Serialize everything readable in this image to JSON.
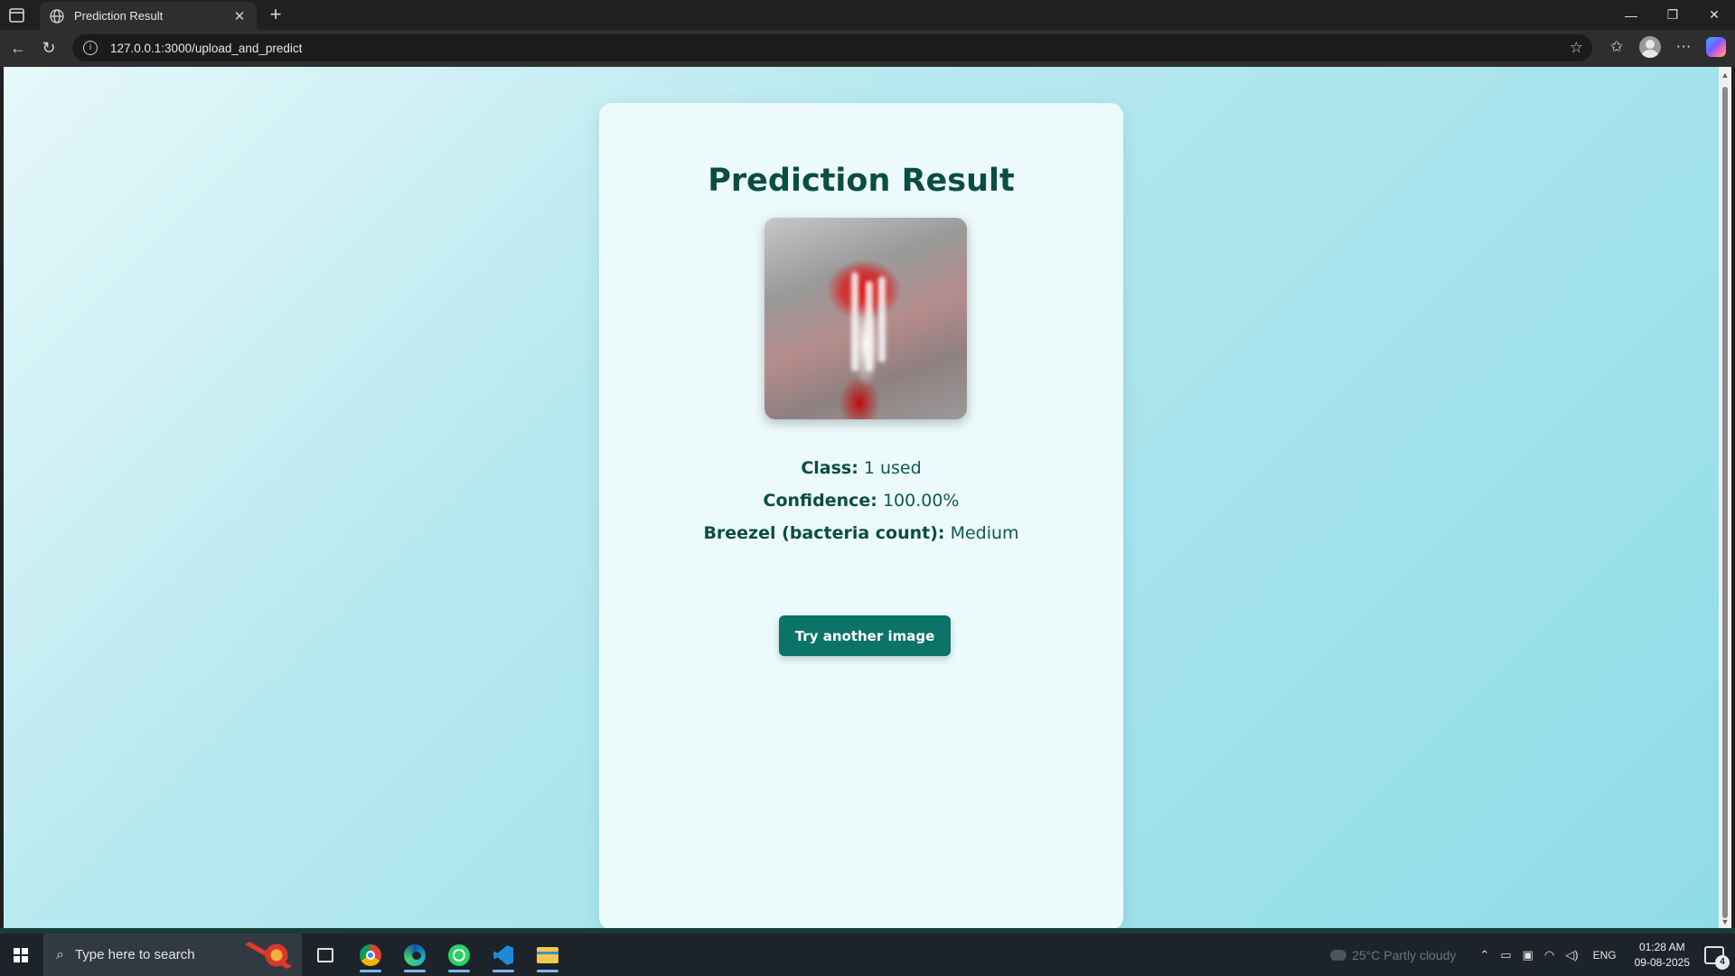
{
  "browser": {
    "tab_title": "Prediction Result",
    "tab_close": "✕",
    "new_tab": "+",
    "url": "127.0.0.1:3000/upload_and_predict",
    "window_controls": {
      "minimize": "—",
      "restore": "❐",
      "close": "✕"
    }
  },
  "page": {
    "heading": "Prediction Result",
    "class_label": "Class:",
    "class_value": "1 used",
    "confidence_label": "Confidence:",
    "confidence_value": "100.00%",
    "breezel_label": "Breezel (bacteria count):",
    "breezel_value": "Medium",
    "button_label": "Try another image"
  },
  "taskbar": {
    "search_placeholder": "Type here to search",
    "weather": "25°C  Partly cloudy",
    "language": "ENG",
    "time": "01:28 AM",
    "date": "09-08-2025",
    "notification_count": "4",
    "pinned_apps": [
      "task-view",
      "chrome",
      "edge",
      "whatsapp",
      "vscode",
      "file-explorer"
    ]
  },
  "colors": {
    "heading": "#0b4d42",
    "button": "#0b7368",
    "card": "#ecfafc",
    "background_start": "#e6f8fa",
    "background_end": "#8fdce8"
  }
}
